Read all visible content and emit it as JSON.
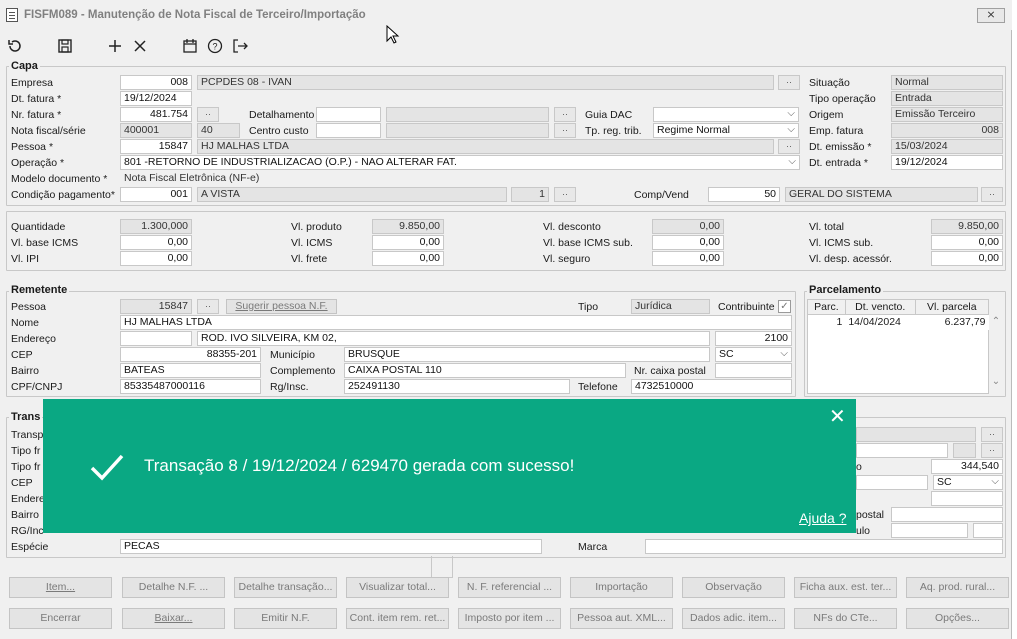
{
  "window": {
    "title": "FISFM089 - Manutenção de Nota Fiscal de Terceiro/Importação",
    "close": "⨯"
  },
  "capa": {
    "group": "Capa",
    "empresa": {
      "label": "Empresa",
      "code": "008",
      "name": "PCPDES 08 - IVAN"
    },
    "dt_fatura": {
      "label": "Dt. fatura *",
      "value": "19/12/2024"
    },
    "nr_fatura": {
      "label": "Nr. fatura *",
      "value": "481.754"
    },
    "detalhamento": {
      "label": "Detalhamento",
      "value": ""
    },
    "guia_dac": {
      "label": "Guia DAC",
      "value": ""
    },
    "nota_fiscal": {
      "label": "Nota fiscal/série",
      "value": "400001",
      "serie": "40"
    },
    "centro_custo": {
      "label": "Centro custo",
      "value": ""
    },
    "tp_reg_trib": {
      "label": "Tp. reg. trib.",
      "value": "Regime Normal"
    },
    "pessoa": {
      "label": "Pessoa *",
      "code": "15847",
      "name": "HJ MALHAS LTDA"
    },
    "operacao": {
      "label": "Operação *",
      "value": "801 -RETORNO DE INDUSTRIALIZACAO (O.P.) - NAO ALTERAR FAT."
    },
    "modelo": {
      "label": "Modelo documento *",
      "value": "Nota Fiscal Eletrônica (NF-e)"
    },
    "condicao": {
      "label": "Condição pagamento*",
      "code": "001",
      "name": "A VISTA",
      "parcelas": "1"
    },
    "comp_vend": {
      "label": "Comp/Vend",
      "code": "50",
      "name": "GERAL DO SISTEMA"
    },
    "situacao": {
      "label": "Situação",
      "value": "Normal"
    },
    "tipo_operacao": {
      "label": "Tipo operação",
      "value": "Entrada"
    },
    "origem": {
      "label": "Origem",
      "value": "Emissão Terceiro"
    },
    "emp_fatura": {
      "label": "Emp. fatura",
      "value": "008"
    },
    "dt_emissao": {
      "label": "Dt. emissão *",
      "value": "15/03/2024"
    },
    "dt_entrada": {
      "label": "Dt. entrada *",
      "value": "19/12/2024"
    }
  },
  "totais": {
    "quantidade": {
      "label": "Quantidade",
      "value": "1.300,000"
    },
    "base_icms": {
      "label": "Vl. base ICMS",
      "value": "0,00"
    },
    "ipi": {
      "label": "Vl. IPI",
      "value": "0,00"
    },
    "produto": {
      "label": "Vl. produto",
      "value": "9.850,00"
    },
    "icms": {
      "label": "Vl. ICMS",
      "value": "0,00"
    },
    "frete": {
      "label": "Vl. frete",
      "value": "0,00"
    },
    "desconto": {
      "label": "Vl. desconto",
      "value": "0,00"
    },
    "base_icms_sub": {
      "label": "Vl. base ICMS sub.",
      "value": "0,00"
    },
    "seguro": {
      "label": "Vl. seguro",
      "value": "0,00"
    },
    "total": {
      "label": "Vl. total",
      "value": "9.850,00"
    },
    "icms_sub": {
      "label": "Vl. ICMS sub.",
      "value": "0,00"
    },
    "desp": {
      "label": "Vl. desp. acessór.",
      "value": "0,00"
    }
  },
  "remetente": {
    "group": "Remetente",
    "pessoa": {
      "label": "Pessoa",
      "value": "15847"
    },
    "sugerir": "Sugerir pessoa N.F.",
    "tipo": {
      "label": "Tipo",
      "value": "Jurídica"
    },
    "contribuinte": {
      "label": "Contribuinte",
      "checked": "✓"
    },
    "nome": {
      "label": "Nome",
      "value": "HJ MALHAS LTDA"
    },
    "endereco": {
      "label": "Endereço",
      "value": "ROD. IVO SILVEIRA, KM 02,",
      "numero": "2100"
    },
    "cep": {
      "label": "CEP",
      "value": "88355-201"
    },
    "municipio": {
      "label": "Município",
      "value": "BRUSQUE",
      "uf": "SC"
    },
    "bairro": {
      "label": "Bairro",
      "value": "BATEAS"
    },
    "complemento": {
      "label": "Complemento",
      "value": "CAIXA POSTAL 110"
    },
    "caixa_postal": {
      "label": "Nr. caixa postal",
      "value": ""
    },
    "cpf": {
      "label": "CPF/CNPJ",
      "value": "85335487000116"
    },
    "rg": {
      "label": "Rg/Insc.",
      "value": "252491130"
    },
    "telefone": {
      "label": "Telefone",
      "value": "4732510000"
    }
  },
  "parcelamento": {
    "group": "Parcelamento",
    "headers": [
      "Parc.",
      "Dt. vencto.",
      "Vl. parcela"
    ],
    "rows": [
      [
        "1",
        "14/04/2024",
        "6.237,79"
      ]
    ]
  },
  "transportadora": {
    "group": "Trans",
    "labels": [
      "Transp",
      "Tipo fr",
      "Tipo fr",
      "CEP",
      "Endere",
      "Bairro",
      "RG/Inc"
    ],
    "peso": "344,540",
    "uf": "SC",
    "postal_label": "postal",
    "ulo_label": "ulo",
    "o_label": "o",
    "especie": {
      "label": "Espécie",
      "value": "PECAS"
    },
    "marca": {
      "label": "Marca",
      "value": ""
    }
  },
  "buttons_row1": [
    "Item...",
    "Detalhe N.F. ...",
    "Detalhe transação...",
    "Visualizar total...",
    "N. F. referencial ...",
    "Importação",
    "Observação",
    "Ficha aux. est. ter...",
    "Aq. prod. rural..."
  ],
  "buttons_row2": [
    "Encerrar",
    "Baixar...",
    "Emitir N.F.",
    "Cont. item rem. ret...",
    "Imposto por item ...",
    "Pessoa aut. XML...",
    "Dados adic. item...",
    "NFs do CTe...",
    "Opções..."
  ],
  "toast": {
    "message": "Transação 8 / 19/12/2024 / 629470 gerada com sucesso!",
    "help": "Ajuda ?",
    "close": "✕"
  },
  "lookup_glyph": "··",
  "colors": {
    "toast": "#0aa883",
    "window": "#f0f0f0"
  }
}
